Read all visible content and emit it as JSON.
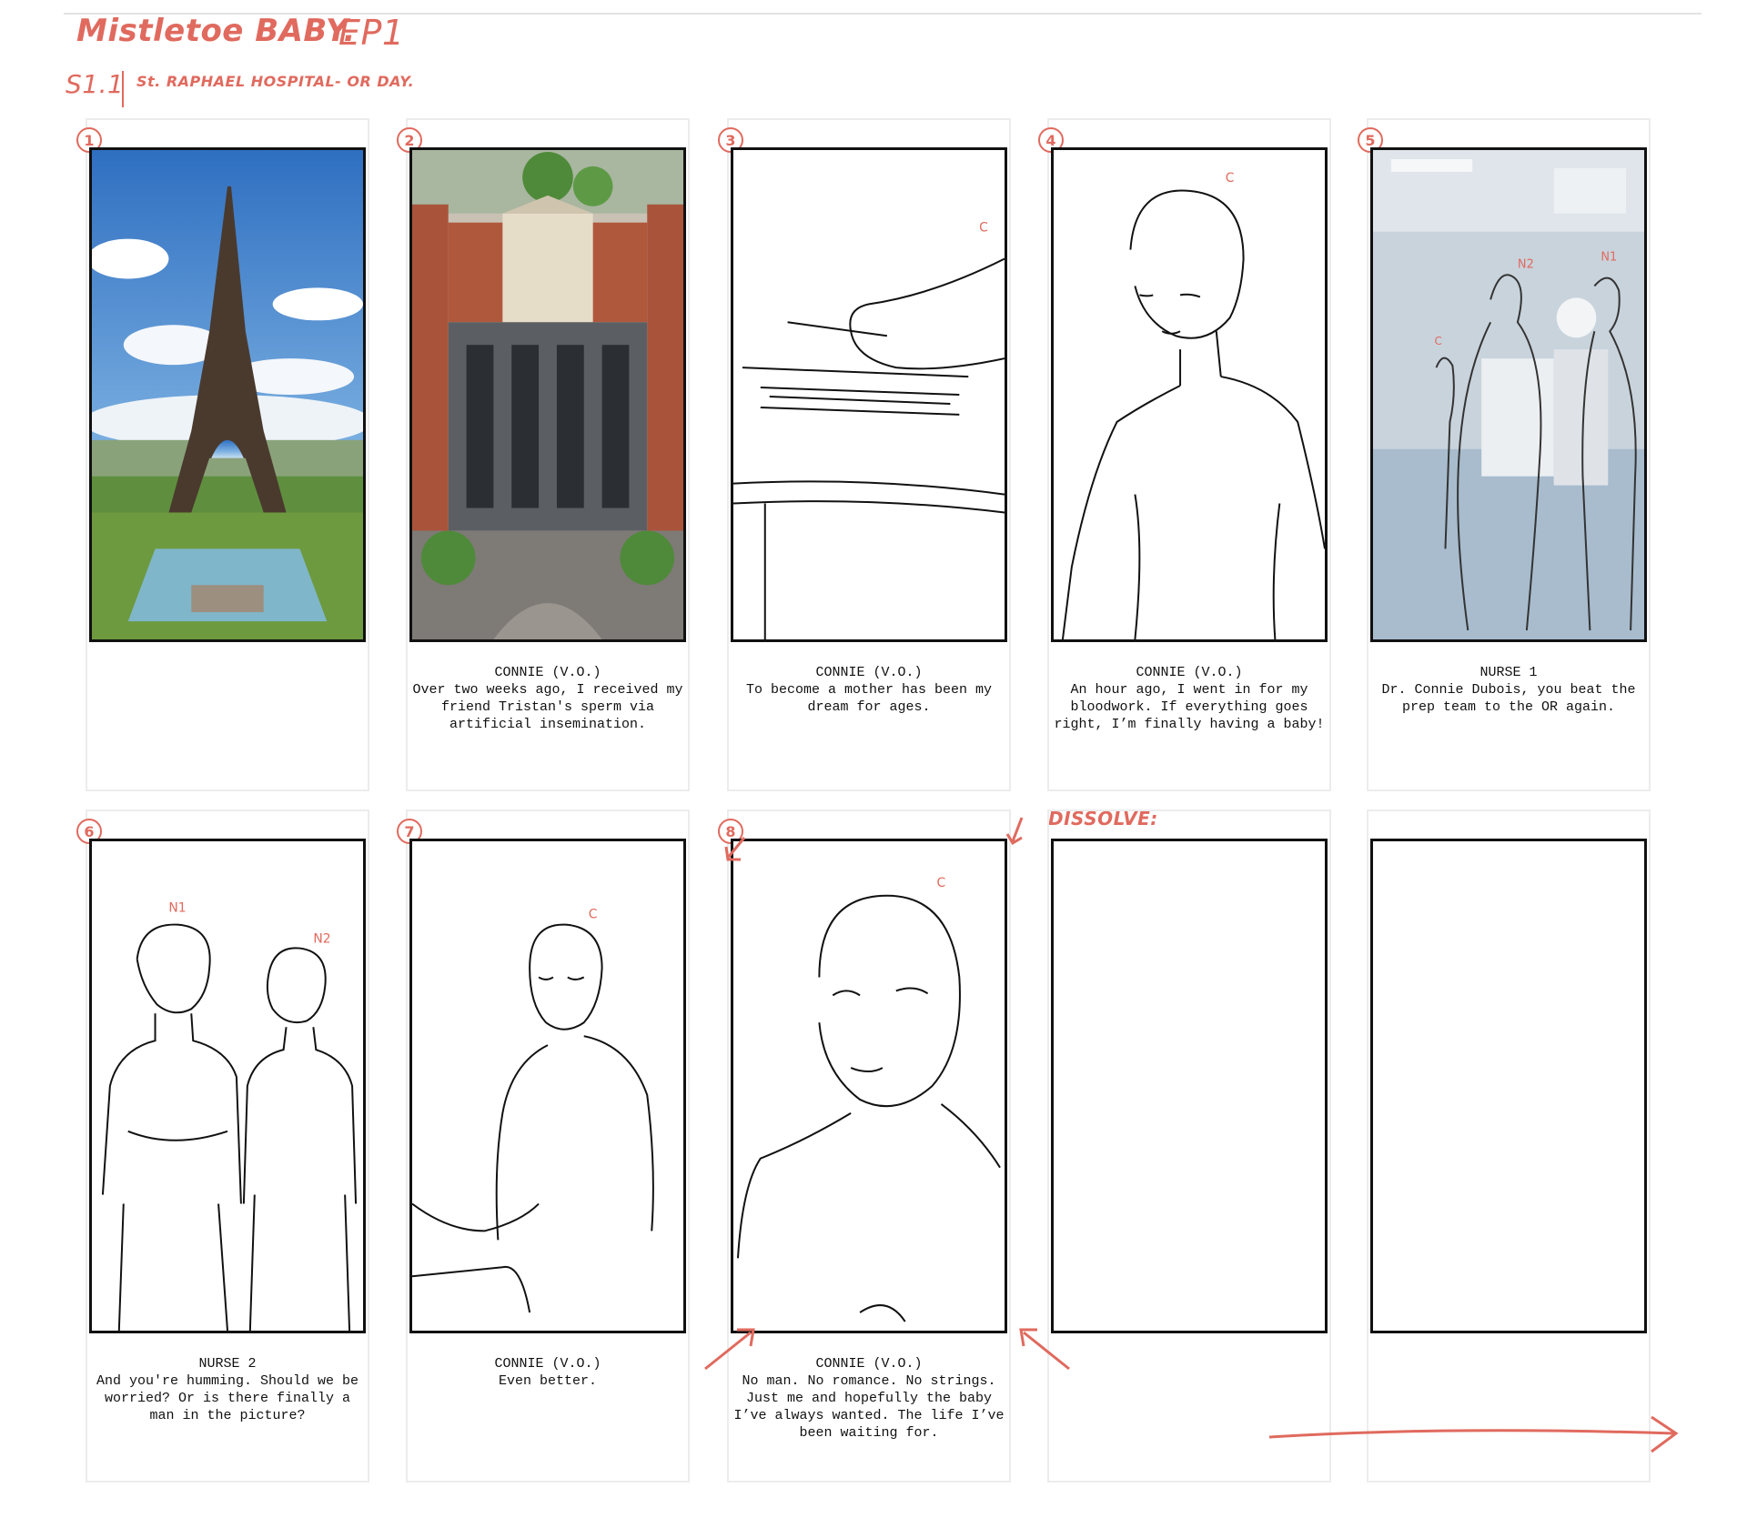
{
  "header": {
    "show_title": "Mistletoe BABY.",
    "episode": "EP1",
    "scene_number": "S1.1",
    "scene_location": "St. RAPHAEL HOSPITAL- OR DAY."
  },
  "transition_note": "DISSOLVE:",
  "colors": {
    "annotation": "#e06a5e",
    "frame": "#111111",
    "guide": "#ececec"
  },
  "panels": [
    {
      "number": "1",
      "speaker": "",
      "dialogue": "",
      "char_marks": []
    },
    {
      "number": "2",
      "speaker": "CONNIE (V.O.)",
      "dialogue": "Over two weeks ago, I received my friend Tristan's sperm via artificial insemination.",
      "char_marks": []
    },
    {
      "number": "3",
      "speaker": "CONNIE (V.O.)",
      "dialogue": "To become a mother has been my dream for ages.",
      "char_marks": [
        "C"
      ]
    },
    {
      "number": "4",
      "speaker": "CONNIE (V.O.)",
      "dialogue": "An hour ago, I went in for my bloodwork. If everything goes right, I’m finally having a baby!",
      "char_marks": [
        "C"
      ]
    },
    {
      "number": "5",
      "speaker": "NURSE 1",
      "dialogue": "Dr. Connie Dubois, you beat the prep team to the OR again.",
      "char_marks": [
        "N2",
        "N1",
        "C"
      ]
    },
    {
      "number": "6",
      "speaker": "NURSE 2",
      "dialogue": "And you're humming. Should we be worried? Or is there finally a man in the picture?",
      "char_marks": [
        "N1",
        "N2"
      ]
    },
    {
      "number": "7",
      "speaker": "CONNIE (V.O.)",
      "dialogue": "Even better.",
      "char_marks": [
        "C"
      ]
    },
    {
      "number": "8",
      "speaker": "CONNIE (V.O.)",
      "dialogue": "No man. No romance. No strings. Just me and hopefully the baby I’ve always wanted. The life I’ve been waiting for.",
      "char_marks": [
        "C"
      ]
    },
    {
      "number": "",
      "speaker": "",
      "dialogue": "",
      "char_marks": []
    },
    {
      "number": "",
      "speaker": "",
      "dialogue": "",
      "char_marks": []
    }
  ]
}
